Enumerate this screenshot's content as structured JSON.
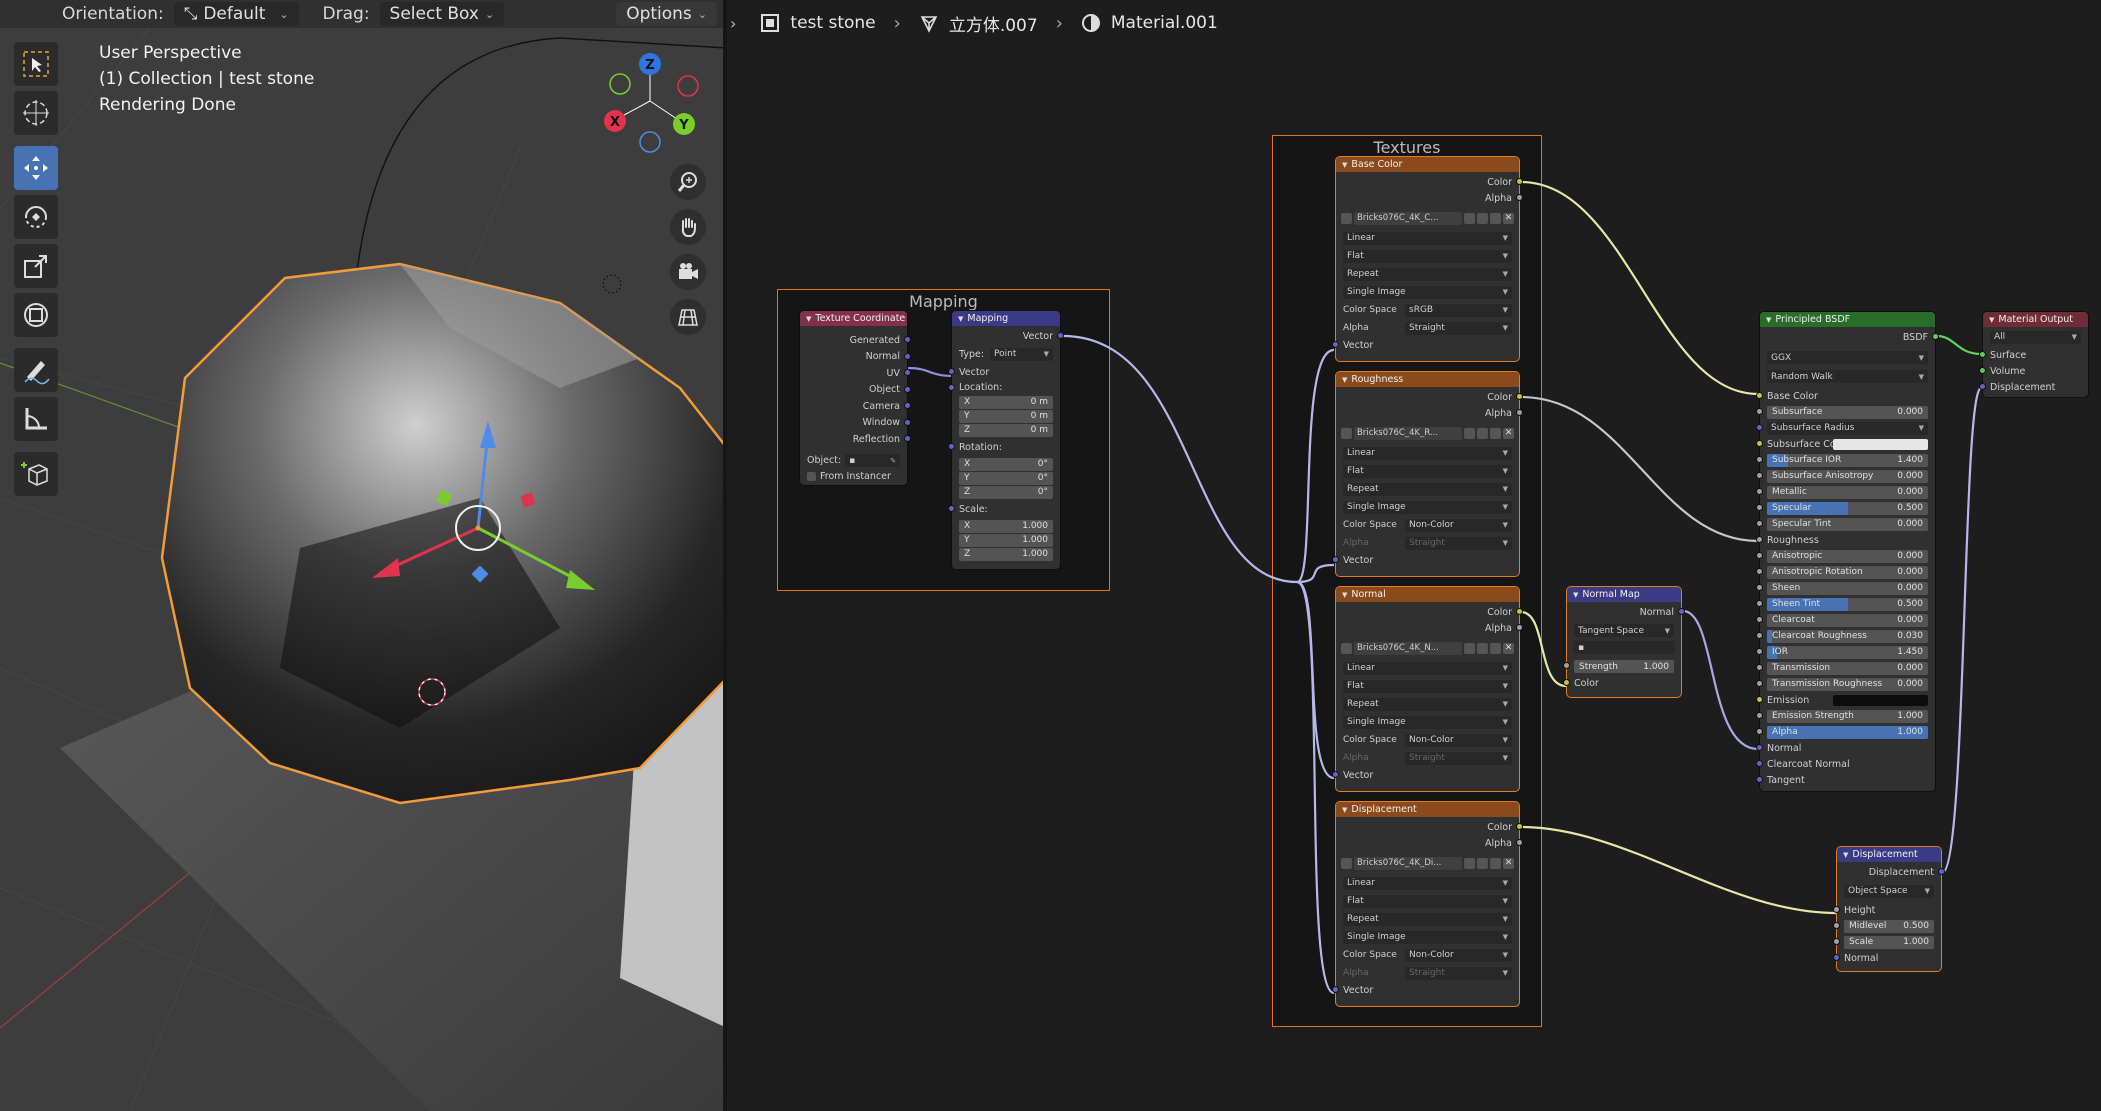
{
  "viewport": {
    "header": {
      "orientation_label": "Orientation:",
      "orientation_value": "Default",
      "drag_label": "Drag:",
      "drag_value": "Select Box",
      "options_label": "Options"
    },
    "overlay": {
      "line1": "User Perspective",
      "line2": "(1) Collection | test stone",
      "line3": "Rendering Done"
    },
    "gizmo": {
      "x": "X",
      "y": "Y",
      "z": "Z"
    },
    "tools": [
      "select-box-icon",
      "cursor-icon",
      "move-icon",
      "rotate-icon",
      "scale-icon",
      "transform-icon",
      "annotate-icon",
      "measure-icon",
      "add-cube-icon"
    ],
    "colors": {
      "selection_outline": "#f29c38",
      "active_tool": "#4772b3"
    }
  },
  "breadcrumb": {
    "object": "test stone",
    "mesh": "立方体.007",
    "material": "Material.001"
  },
  "frames": {
    "mapping": "Mapping",
    "textures": "Textures"
  },
  "nodes": {
    "texture_coordinate": {
      "title": "Texture Coordinate",
      "outputs": [
        "Generated",
        "Normal",
        "UV",
        "Object",
        "Camera",
        "Window",
        "Reflection"
      ],
      "object_label": "Object:",
      "from_instancer": "From Instancer"
    },
    "mapping": {
      "title": "Mapping",
      "output": "Vector",
      "type_label": "Type:",
      "type_value": "Point",
      "vector": "Vector",
      "location_label": "Location:",
      "location": [
        {
          "k": "X",
          "v": "0 m"
        },
        {
          "k": "Y",
          "v": "0 m"
        },
        {
          "k": "Z",
          "v": "0 m"
        }
      ],
      "rotation_label": "Rotation:",
      "rotation": [
        {
          "k": "X",
          "v": "0°"
        },
        {
          "k": "Y",
          "v": "0°"
        },
        {
          "k": "Z",
          "v": "0°"
        }
      ],
      "scale_label": "Scale:",
      "scale": [
        {
          "k": "X",
          "v": "1.000"
        },
        {
          "k": "Y",
          "v": "1.000"
        },
        {
          "k": "Z",
          "v": "1.000"
        }
      ]
    },
    "textures": [
      {
        "title": "Base Color",
        "image": "Bricks076C_4K_C...",
        "interpolation": "Linear",
        "projection": "Flat",
        "extension": "Repeat",
        "source": "Single Image",
        "colorspace_label": "Color Space",
        "colorspace": "sRGB",
        "alpha_label": "Alpha",
        "alpha": "Straight",
        "alpha_dim": false
      },
      {
        "title": "Roughness",
        "image": "Bricks076C_4K_R...",
        "interpolation": "Linear",
        "projection": "Flat",
        "extension": "Repeat",
        "source": "Single Image",
        "colorspace_label": "Color Space",
        "colorspace": "Non-Color",
        "alpha_label": "Alpha",
        "alpha": "Straight",
        "alpha_dim": true
      },
      {
        "title": "Normal",
        "image": "Bricks076C_4K_N...",
        "interpolation": "Linear",
        "projection": "Flat",
        "extension": "Repeat",
        "source": "Single Image",
        "colorspace_label": "Color Space",
        "colorspace": "Non-Color",
        "alpha_label": "Alpha",
        "alpha": "Straight",
        "alpha_dim": true
      },
      {
        "title": "Displacement",
        "image": "Bricks076C_4K_Di...",
        "interpolation": "Linear",
        "projection": "Flat",
        "extension": "Repeat",
        "source": "Single Image",
        "colorspace_label": "Color Space",
        "colorspace": "Non-Color",
        "alpha_label": "Alpha",
        "alpha": "Straight",
        "alpha_dim": true
      }
    ],
    "tex_sockets": {
      "color": "Color",
      "alpha": "Alpha",
      "vector": "Vector"
    },
    "normal_map": {
      "title": "Normal Map",
      "output": "Normal",
      "space": "Tangent Space",
      "uv": "",
      "strength_label": "Strength",
      "strength": "1.000",
      "input": "Color"
    },
    "principled": {
      "title": "Principled BSDF",
      "output": "BSDF",
      "distribution": "GGX",
      "subsurface_method": "Random Walk",
      "base_color": "Base Color",
      "subsurface": {
        "label": "Subsurface",
        "value": "0.000",
        "fill": 0
      },
      "subsurface_radius": "Subsurface Radius",
      "subsurface_color": "Subsurface Co...",
      "subsurface_color_hex": "#e6e6e6",
      "subsurface_ior": {
        "label": "Subsurface IOR",
        "value": "1.400",
        "fill": 0.13
      },
      "subsurface_anisotropy": {
        "label": "Subsurface Anisotropy",
        "value": "0.000",
        "fill": 0
      },
      "metallic": {
        "label": "Metallic",
        "value": "0.000",
        "fill": 0
      },
      "specular": {
        "label": "Specular",
        "value": "0.500",
        "fill": 0.5
      },
      "specular_tint": {
        "label": "Specular Tint",
        "value": "0.000",
        "fill": 0
      },
      "roughness": "Roughness",
      "anisotropic": {
        "label": "Anisotropic",
        "value": "0.000",
        "fill": 0
      },
      "anisotropic_rotation": {
        "label": "Anisotropic Rotation",
        "value": "0.000",
        "fill": 0
      },
      "sheen": {
        "label": "Sheen",
        "value": "0.000",
        "fill": 0
      },
      "sheen_tint": {
        "label": "Sheen Tint",
        "value": "0.500",
        "fill": 0.5
      },
      "clearcoat": {
        "label": "Clearcoat",
        "value": "0.000",
        "fill": 0
      },
      "clearcoat_roughness": {
        "label": "Clearcoat Roughness",
        "value": "0.030",
        "fill": 0.03
      },
      "ior": {
        "label": "IOR",
        "value": "1.450",
        "fill": 0.06
      },
      "transmission": {
        "label": "Transmission",
        "value": "0.000",
        "fill": 0
      },
      "transmission_roughness": {
        "label": "Transmission Roughness",
        "value": "0.000",
        "fill": 0
      },
      "emission": "Emission",
      "emission_hex": "#0c0c0c",
      "emission_strength": {
        "label": "Emission Strength",
        "value": "1.000",
        "fill": 0
      },
      "alpha": {
        "label": "Alpha",
        "value": "1.000",
        "fill": 1
      },
      "normal": "Normal",
      "clearcoat_normal": "Clearcoat Normal",
      "tangent": "Tangent"
    },
    "material_output": {
      "title": "Material Output",
      "target": "All",
      "inputs": [
        "Surface",
        "Volume",
        "Displacement"
      ]
    },
    "displacement": {
      "title": "Displacement",
      "output": "Displacement",
      "space": "Object Space",
      "height": "Height",
      "midlevel": {
        "label": "Midlevel",
        "value": "0.500"
      },
      "scale": {
        "label": "Scale",
        "value": "1.000"
      },
      "normal": "Normal"
    }
  }
}
